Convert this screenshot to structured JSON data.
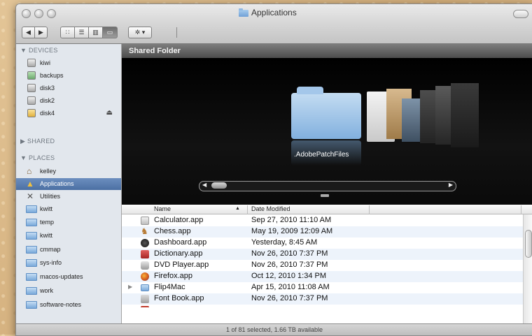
{
  "window": {
    "title": "Applications"
  },
  "toolbar": {
    "back": "◀",
    "forward": "▶",
    "view_icon": "∷",
    "view_list": "☰",
    "view_column": "▥",
    "view_coverflow": "▭",
    "action": "✲ ▾"
  },
  "sidebar": {
    "devices_header": "▼ DEVICES",
    "devices": [
      {
        "label": "kiwi",
        "icon": "harddisk-icon"
      },
      {
        "label": "backups",
        "icon": "harddisk-icon"
      },
      {
        "label": "disk3",
        "icon": "harddisk-icon"
      },
      {
        "label": "disk2",
        "icon": "harddisk-icon"
      },
      {
        "label": "disk4",
        "icon": "harddisk-icon",
        "eject": "⏏"
      }
    ],
    "shared_header": "▶ SHARED",
    "places_header": "▼ PLACES",
    "places": [
      {
        "label": "kelley"
      },
      {
        "label": "Applications",
        "selected": true
      },
      {
        "label": "Utilities"
      },
      {
        "label": "kwitt"
      },
      {
        "label": "temp"
      },
      {
        "label": "kwitt"
      },
      {
        "label": "cmmap"
      },
      {
        "label": "sys-info"
      },
      {
        "label": "macos-updates"
      },
      {
        "label": "work"
      },
      {
        "label": "software-notes"
      }
    ]
  },
  "pathbar": {
    "label": "Shared Folder"
  },
  "coverflow": {
    "caption": ".AdobePatchFiles",
    "left_arrow": "◀",
    "right_arrow": "▶"
  },
  "list": {
    "columns": {
      "name": "Name",
      "sort_indicator": "▲",
      "date": "Date Modified"
    },
    "rows": [
      {
        "name": "Calculator.app",
        "date": "Sep 27, 2010 11:10 AM"
      },
      {
        "name": "Chess.app",
        "date": "May 19, 2009 12:09 AM"
      },
      {
        "name": "Dashboard.app",
        "date": "Yesterday, 8:45 AM"
      },
      {
        "name": "Dictionary.app",
        "date": "Nov 26, 2010 7:37 PM"
      },
      {
        "name": "DVD Player.app",
        "date": "Nov 26, 2010 7:37 PM"
      },
      {
        "name": "Firefox.app",
        "date": "Oct 12, 2010 1:34 PM"
      },
      {
        "name": "Flip4Mac",
        "date": "Apr 15, 2010 11:08 AM",
        "folder": true,
        "disclosure": "▶"
      },
      {
        "name": "Font Book.app",
        "date": "Nov 26, 2010 7:37 PM"
      }
    ]
  },
  "status": {
    "text": "1 of 81 selected, 1.66 TB available"
  }
}
